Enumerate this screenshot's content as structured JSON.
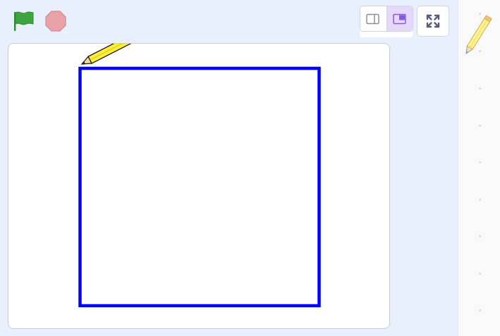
{
  "toolbar": {
    "green_flag_icon": "green-flag-icon",
    "stop_icon": "stop-icon",
    "small_stage_icon": "small-stage-layout-icon",
    "large_stage_icon": "large-stage-layout-icon",
    "fullscreen_icon": "fullscreen-icon",
    "selected_layout": "large-stage"
  },
  "stage": {
    "sprite_icon": "pencil-icon",
    "pen_color": "#0000ff",
    "drawn_shape": "square"
  },
  "sidebar": {
    "sprite_icon": "pencil-icon"
  },
  "colors": {
    "background": "#e8f0fd",
    "flag_green": "#3ca63c",
    "stop_red": "#e8a2a8",
    "selected_layout_bg": "#e5d8fb",
    "accent_purple": "#855cd6"
  }
}
